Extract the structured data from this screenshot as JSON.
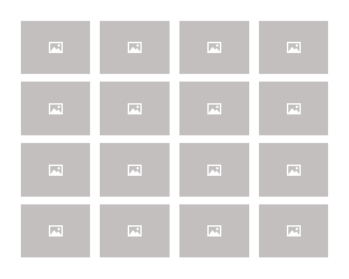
{
  "gallery": {
    "tile_color": "#c3bfbf",
    "icon_color": "#ffffff",
    "rows": 4,
    "columns": 4,
    "tiles": [
      {
        "icon": "image-placeholder-icon"
      },
      {
        "icon": "image-placeholder-icon"
      },
      {
        "icon": "image-placeholder-icon"
      },
      {
        "icon": "image-placeholder-icon"
      },
      {
        "icon": "image-placeholder-icon"
      },
      {
        "icon": "image-placeholder-icon"
      },
      {
        "icon": "image-placeholder-icon"
      },
      {
        "icon": "image-placeholder-icon"
      },
      {
        "icon": "image-placeholder-icon"
      },
      {
        "icon": "image-placeholder-icon"
      },
      {
        "icon": "image-placeholder-icon"
      },
      {
        "icon": "image-placeholder-icon"
      },
      {
        "icon": "image-placeholder-icon"
      },
      {
        "icon": "image-placeholder-icon"
      },
      {
        "icon": "image-placeholder-icon"
      },
      {
        "icon": "image-placeholder-icon"
      }
    ]
  }
}
